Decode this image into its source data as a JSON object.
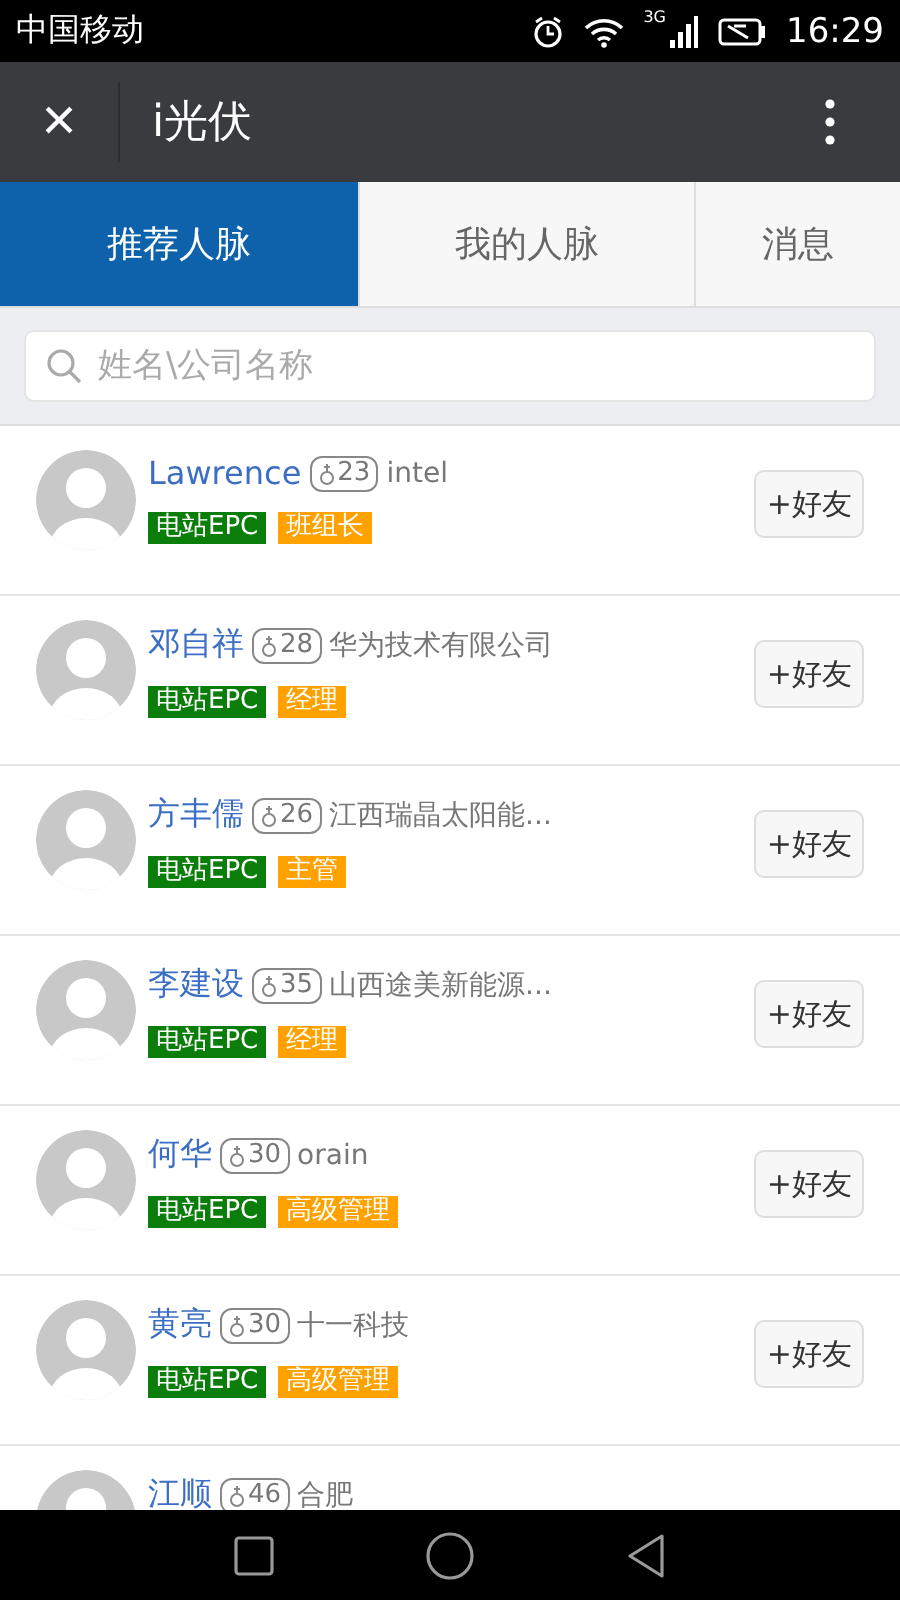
{
  "status_bar": {
    "carrier": "中国移动",
    "network": "3G",
    "time": "16:29"
  },
  "app_bar": {
    "close": "×",
    "title": "i光伏"
  },
  "tabs": [
    {
      "label": "推荐人脉",
      "selected": true
    },
    {
      "label": "我的人脉",
      "selected": false
    },
    {
      "label": "消息",
      "selected": false
    }
  ],
  "search": {
    "placeholder": "姓名\\公司名称"
  },
  "people": [
    {
      "name": "Lawrence",
      "age": "23",
      "company": "intel",
      "tags": [
        {
          "label": "电站EPC",
          "color": "#0a7d0a"
        },
        {
          "label": "班组长",
          "color": "#ffa200"
        }
      ],
      "button": "+好友"
    },
    {
      "name": "邓自祥",
      "age": "28",
      "company": "华为技术有限公司",
      "tags": [
        {
          "label": "电站EPC",
          "color": "#0a7d0a"
        },
        {
          "label": "经理",
          "color": "#ffa200"
        }
      ],
      "button": "+好友"
    },
    {
      "name": "方丰儒",
      "age": "26",
      "company": "江西瑞晶太阳能...",
      "tags": [
        {
          "label": "电站EPC",
          "color": "#0a7d0a"
        },
        {
          "label": "主管",
          "color": "#ffa200"
        }
      ],
      "button": "+好友"
    },
    {
      "name": "李建设",
      "age": "35",
      "company": "山西途美新能源...",
      "tags": [
        {
          "label": "电站EPC",
          "color": "#0a7d0a"
        },
        {
          "label": "经理",
          "color": "#ffa200"
        }
      ],
      "button": "+好友"
    },
    {
      "name": "何华",
      "age": "30",
      "company": "orain",
      "tags": [
        {
          "label": "电站EPC",
          "color": "#0a7d0a"
        },
        {
          "label": "高级管理",
          "color": "#ffa200"
        }
      ],
      "button": "+好友"
    },
    {
      "name": "黄亮",
      "age": "30",
      "company": "十一科技",
      "tags": [
        {
          "label": "电站EPC",
          "color": "#0a7d0a"
        },
        {
          "label": "高级管理",
          "color": "#ffa200"
        }
      ],
      "button": "+好友"
    },
    {
      "name": "江顺",
      "age": "46",
      "company": "合肥"
    }
  ]
}
